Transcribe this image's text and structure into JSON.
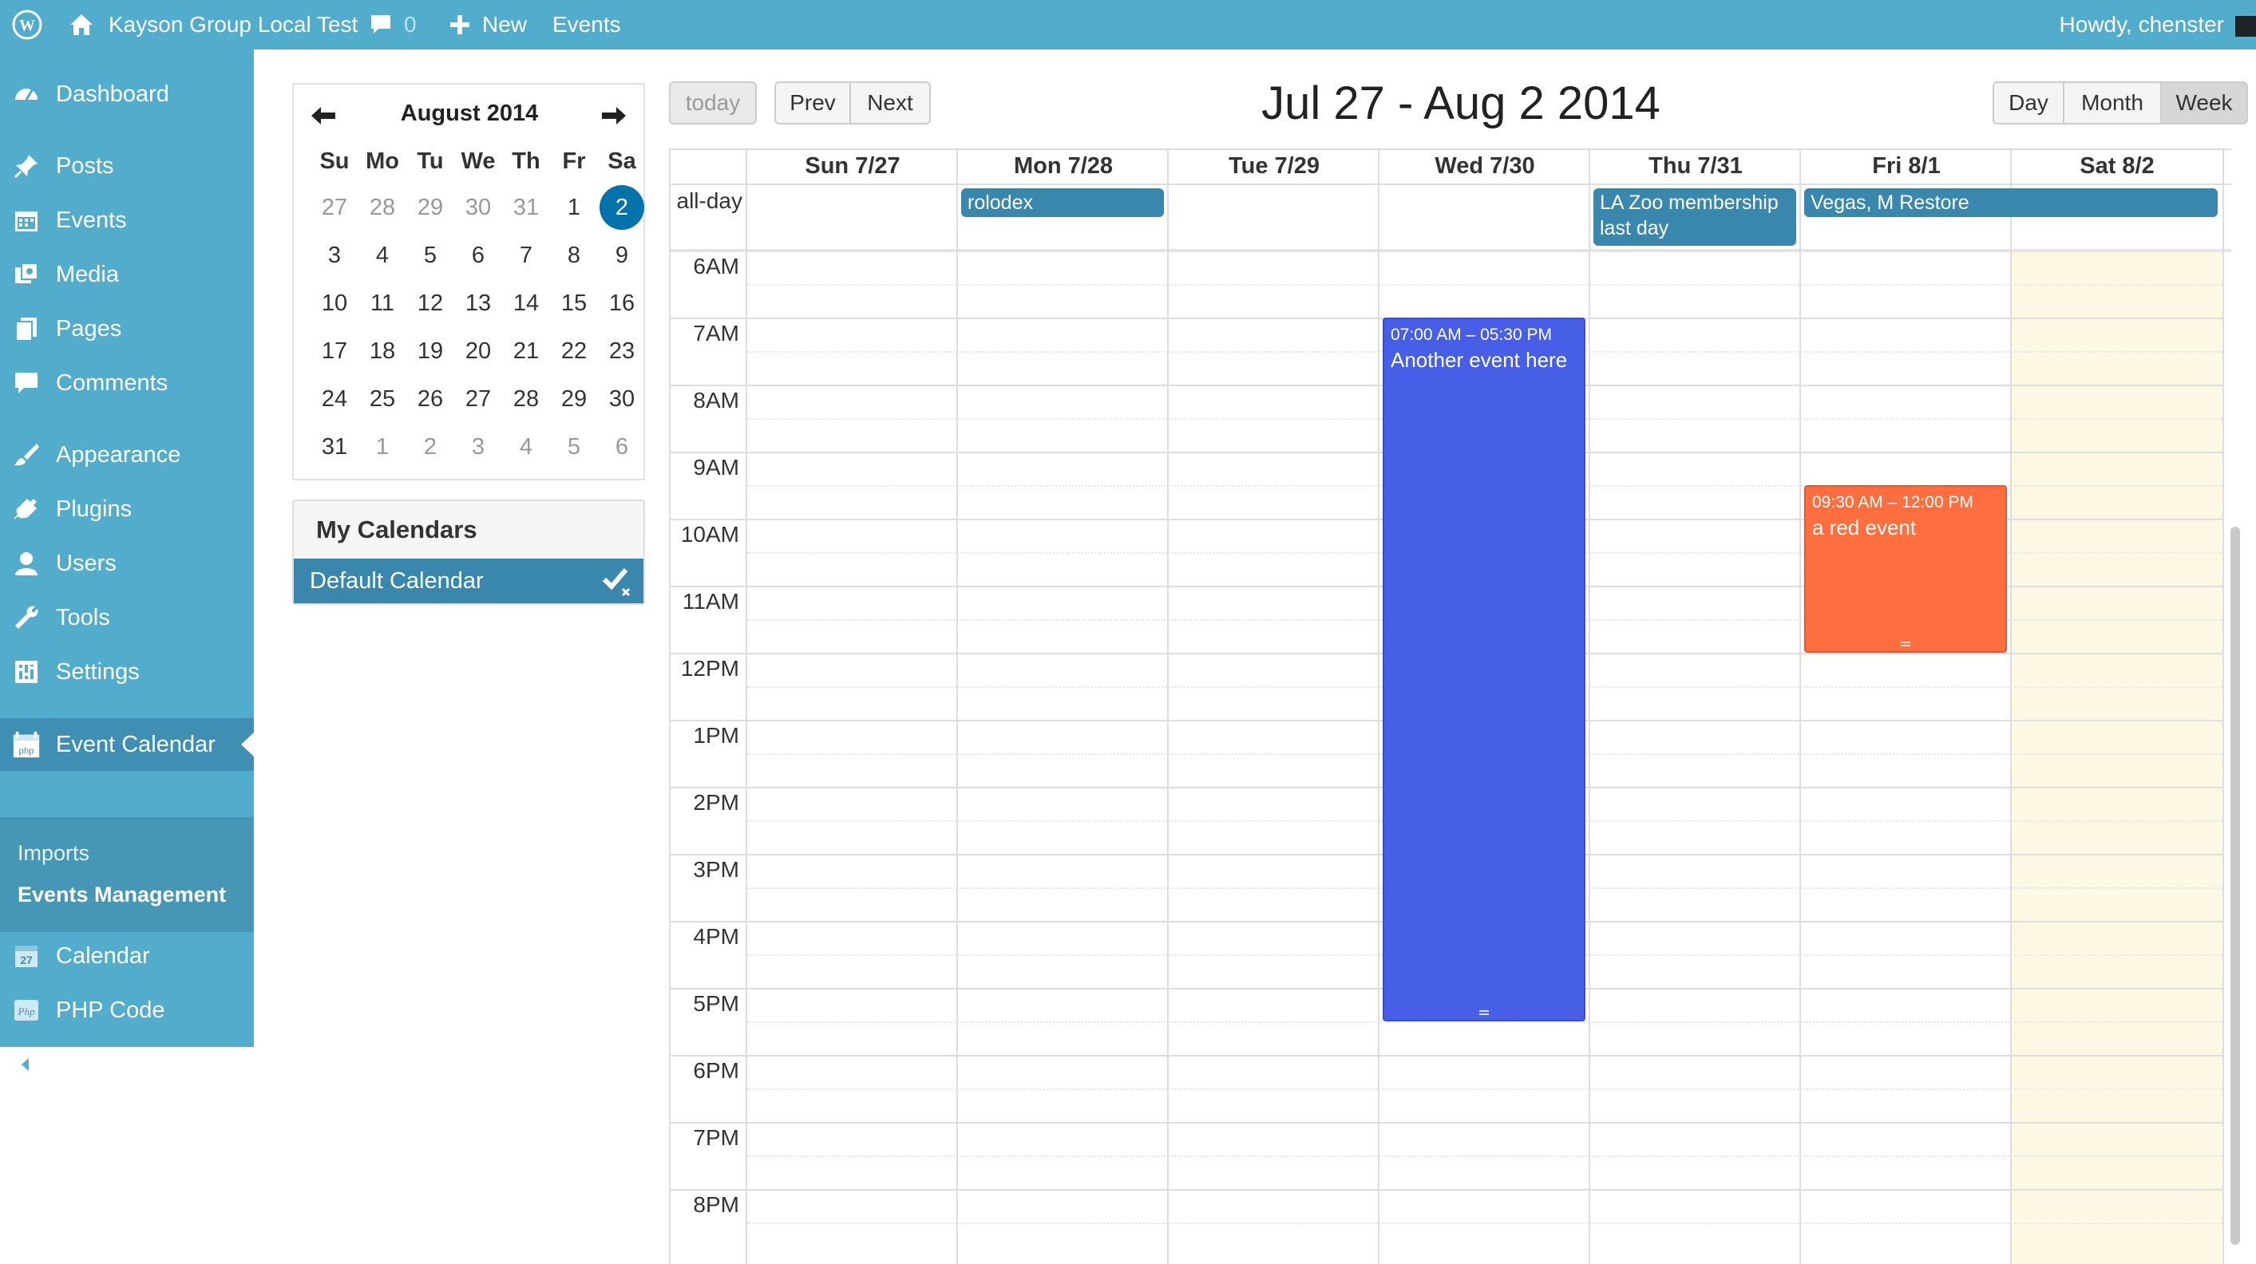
{
  "adminbar": {
    "site_name": "Kayson Group Local Test",
    "comments_count": "0",
    "new_label": "New",
    "events_label": "Events",
    "howdy": "Howdy, chenster"
  },
  "sidebar": {
    "items": [
      {
        "label": "Dashboard",
        "icon": "dashboard-icon"
      },
      {
        "label": "Posts",
        "icon": "pin-icon"
      },
      {
        "label": "Events",
        "icon": "calendar-icon"
      },
      {
        "label": "Media",
        "icon": "media-icon"
      },
      {
        "label": "Pages",
        "icon": "pages-icon"
      },
      {
        "label": "Comments",
        "icon": "comment-icon"
      },
      {
        "label": "Appearance",
        "icon": "brush-icon"
      },
      {
        "label": "Plugins",
        "icon": "plugin-icon"
      },
      {
        "label": "Users",
        "icon": "user-icon"
      },
      {
        "label": "Tools",
        "icon": "wrench-icon"
      },
      {
        "label": "Settings",
        "icon": "settings-icon"
      },
      {
        "label": "Event Calendar",
        "icon": "event-calendar-icon"
      },
      {
        "label": "Calendar",
        "icon": "calendar-27-icon"
      },
      {
        "label": "PHP Code",
        "icon": "php-icon"
      },
      {
        "label": "Collapse menu",
        "icon": "collapse-icon"
      }
    ],
    "submenu": [
      "Imports",
      "Events Management"
    ]
  },
  "minical": {
    "month_label": "August 2014",
    "weekdays": [
      "Su",
      "Mo",
      "Tu",
      "We",
      "Th",
      "Fr",
      "Sa"
    ],
    "weeks": [
      [
        "27",
        "28",
        "29",
        "30",
        "31",
        "1",
        "2"
      ],
      [
        "3",
        "4",
        "5",
        "6",
        "7",
        "8",
        "9"
      ],
      [
        "10",
        "11",
        "12",
        "13",
        "14",
        "15",
        "16"
      ],
      [
        "17",
        "18",
        "19",
        "20",
        "21",
        "22",
        "23"
      ],
      [
        "24",
        "25",
        "26",
        "27",
        "28",
        "29",
        "30"
      ],
      [
        "31",
        "1",
        "2",
        "3",
        "4",
        "5",
        "6"
      ]
    ],
    "selected": "2"
  },
  "mycalendars": {
    "title": "My Calendars",
    "items": [
      "Default Calendar"
    ]
  },
  "toolbar": {
    "today": "today",
    "prev": "Prev",
    "next": "Next",
    "title": "Jul 27 - Aug 2 2014",
    "views": [
      "Day",
      "Month",
      "Week"
    ],
    "active_view": "Week"
  },
  "week": {
    "days": [
      "Sun 7/27",
      "Mon 7/28",
      "Tue 7/29",
      "Wed 7/30",
      "Thu 7/31",
      "Fri 8/1",
      "Sat 8/2"
    ],
    "allday_label": "all-day",
    "hours": [
      "6AM",
      "7AM",
      "8AM",
      "9AM",
      "10AM",
      "11AM",
      "12PM",
      "1PM",
      "2PM",
      "3PM",
      "4PM",
      "5PM",
      "6PM",
      "7PM",
      "8PM"
    ],
    "allday_events": [
      {
        "title": "rolodex",
        "day": 1,
        "span": 1,
        "color": "#3a87ad"
      },
      {
        "title": "LA Zoo membership last day",
        "day": 4,
        "span": 1,
        "color": "#3a87ad"
      },
      {
        "title": "Vegas, M Restore",
        "day": 5,
        "span": 2,
        "color": "#3a87ad"
      }
    ],
    "timed_events": [
      {
        "time": "07:00 AM – 05:30 PM",
        "title": "Another event here",
        "day": 3,
        "start": 7,
        "end": 17.5,
        "color": "#465fe6"
      },
      {
        "time": "09:30 AM – 12:00 PM",
        "title": "a red event",
        "day": 5,
        "start": 9.5,
        "end": 12,
        "color": "#fe6e3e"
      }
    ],
    "today_column": 6
  },
  "colors": {
    "admin_blue": "#52accc",
    "active_menu": "#3e8fb3",
    "selected_day": "#0073aa",
    "today_highlight": "#fcf8e3"
  }
}
